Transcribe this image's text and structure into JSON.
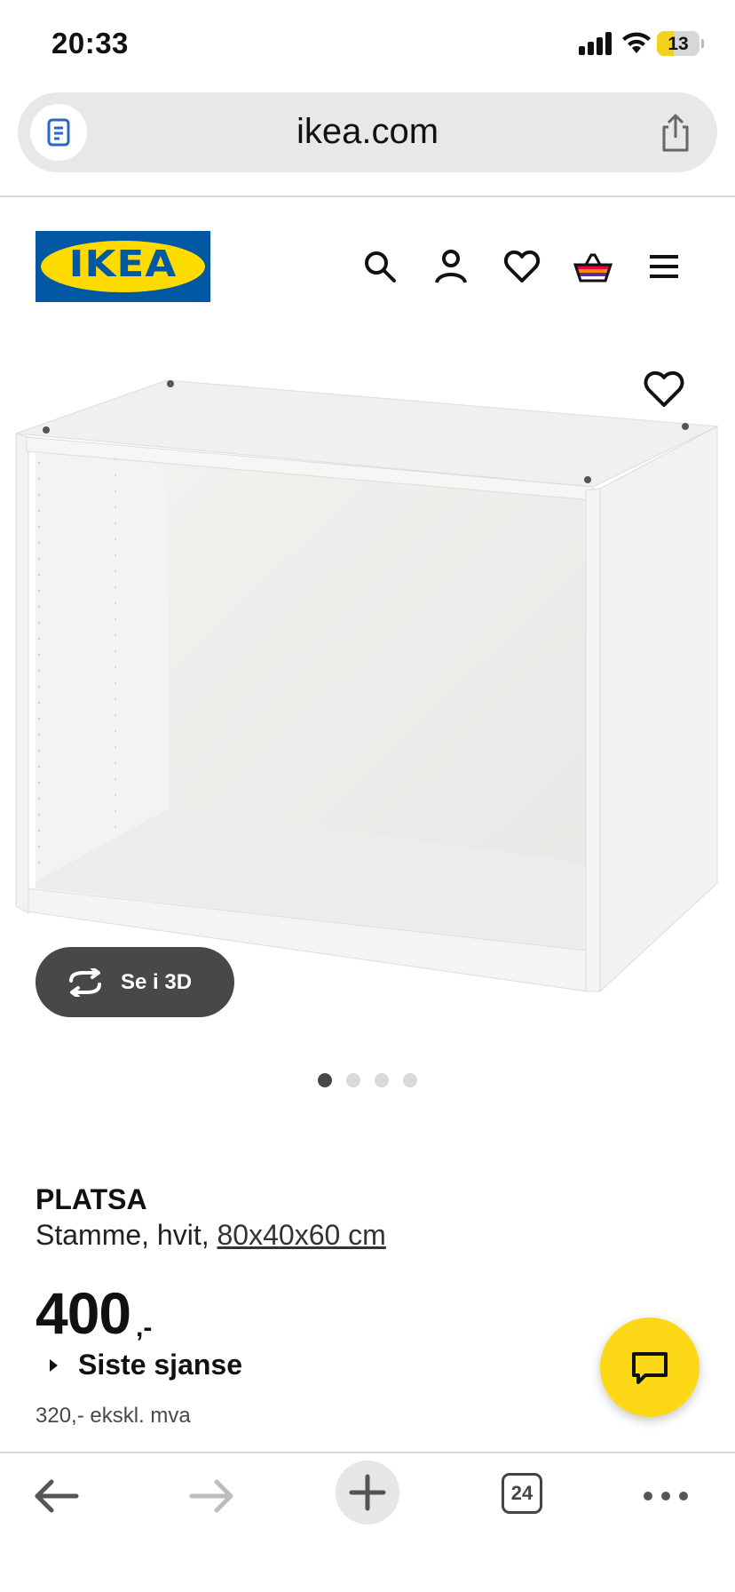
{
  "status_bar": {
    "time": "20:33",
    "battery": "13",
    "battery_level": 0.13
  },
  "browser": {
    "url": "ikea.com",
    "tab_count": "24"
  },
  "site": {
    "logo_text": "IKEA"
  },
  "product": {
    "name": "PLATSA",
    "description_prefix": "Stamme, hvit, ",
    "size_link": "80x40x60 cm",
    "price": "400",
    "price_suffix": ",-",
    "badge": "Siste sjanse",
    "price_ex_vat": "320,- ekskl. mva",
    "see_3d_label": "Se i 3D",
    "image_count": 4,
    "active_image": 1
  },
  "icons": {
    "header": [
      "search-icon",
      "account-icon",
      "heart-icon",
      "basket-icon",
      "menu-icon"
    ],
    "toolbar": [
      "back-arrow-icon",
      "forward-arrow-icon",
      "plus-icon",
      "tabs-icon",
      "more-icon"
    ]
  },
  "colors": {
    "ikea_blue": "#0058a3",
    "ikea_yellow": "#ffdb00",
    "chat_yellow": "#fdd816",
    "dark_button": "#484848"
  }
}
